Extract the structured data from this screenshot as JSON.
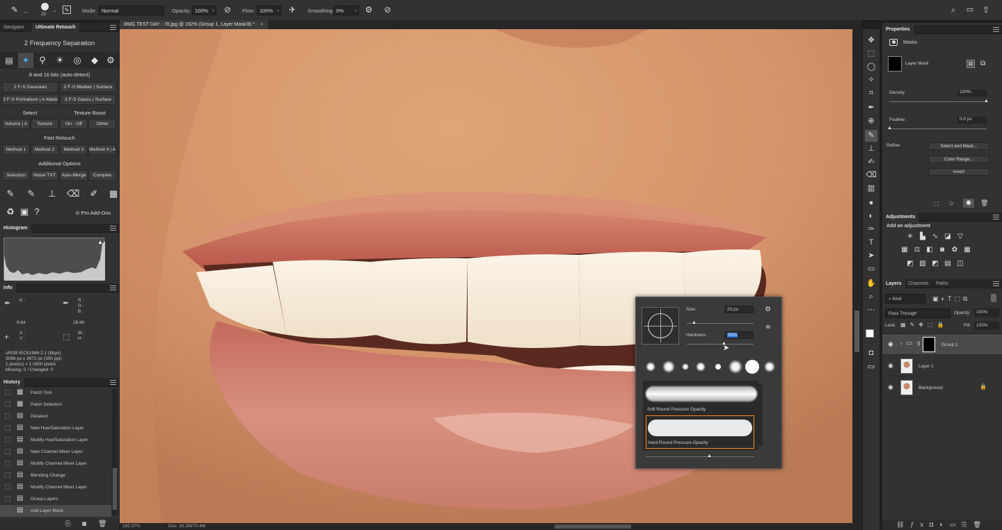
{
  "optbar": {
    "brush_size": "23",
    "mode_label": "Mode:",
    "mode_value": "Normal",
    "opacity_label": "Opacity:",
    "opacity_value": "100%",
    "flow_label": "Flow:",
    "flow_value": "100%",
    "smoothing_label": "Smoothing:",
    "smoothing_value": "0%"
  },
  "left": {
    "tabs": [
      "Navigator",
      "Ultimate Retouch"
    ],
    "ur_title": "2 Frequency Separation",
    "bits_text": "8 and 16 bits (auto-detect)",
    "row1": [
      "2 F-S Gaussian",
      "2 F-S Median | Surface"
    ],
    "row2": [
      "2 F-S Portraiture | A-Mask",
      "3 F-S Gauss | Surface"
    ],
    "select_label": "Select",
    "texture_boost_label": "Texture Boost",
    "row3": [
      "Volume | A",
      "Texture",
      "On - Off",
      "Other"
    ],
    "fast_retouch_label": "Fast Retouch",
    "row4": [
      "Method 1",
      "Method 2",
      "Method 3",
      "Method 4 | A"
    ],
    "additional_label": "Additional Options",
    "row5": [
      "Selection",
      "Noise TXT",
      "Auto-Merge",
      "Complex"
    ],
    "pro_addons": "© Pro Add-Ons",
    "histogram_tab": "Histogram",
    "info_tab": "Info",
    "info": {
      "k": "K :",
      "rgb": "R :\nG :\nB :",
      "bit8": "8-bit",
      "bit16": "16-bit",
      "xy": "X :\nY :",
      "wh": "W :\nH :",
      "profile": "sRGB IEC61966-2.1 (8bpc)",
      "dims": "3096 px x 3972 px (300 ppi)",
      "pixels": "1 pixel(s) = 1.0000 pixels",
      "missing": "Missing: 0 / Changed: 0"
    },
    "history_tab": "History",
    "history": [
      "Patch Tool",
      "Patch Selection",
      "Deselect",
      "New Hue/Saturation Layer",
      "Modify Hue/Saturation Layer",
      "New Channel Mixer Layer",
      "Modify Channel Mixer Layer",
      "Blending Change",
      "Modify Channel Mixer Layer",
      "Group Layers",
      "Add Layer Mask"
    ]
  },
  "doc": {
    "tab_title": "RMG TEST DAY - 78.jpg @ 192% (Group 1, Layer Mask/8) *",
    "zoom": "192.37%",
    "doc_size": "Doc: 35.2M/70.4M"
  },
  "brush_popup": {
    "size_label": "Size:",
    "size_value": "23 px",
    "hardness_label": "Hardness:",
    "hardness_value": "55%",
    "preset1": "Soft Round Pressure Opacity",
    "preset2": "Hard Round Pressure Opacity"
  },
  "properties": {
    "tab": "Properties",
    "masks_label": "Masks",
    "layer_mask": "Layer Mask",
    "density_label": "Density:",
    "density_value": "100%",
    "feather_label": "Feather:",
    "feather_value": "0.0 px",
    "refine_label": "Refine:",
    "select_mask": "Select and Mask...",
    "color_range": "Color Range...",
    "invert": "Invert"
  },
  "adjustments": {
    "tab": "Adjustments",
    "add_label": "Add an adjustment"
  },
  "layers": {
    "tabs": [
      "Layers",
      "Channels",
      "Paths"
    ],
    "kind": "Kind",
    "blend": "Pass Through",
    "opacity_label": "Opacity:",
    "opacity_value": "100%",
    "lock_label": "Lock:",
    "fill_label": "Fill:",
    "fill_value": "100%",
    "items": [
      "Group 1",
      "Layer 1",
      "Background"
    ]
  }
}
